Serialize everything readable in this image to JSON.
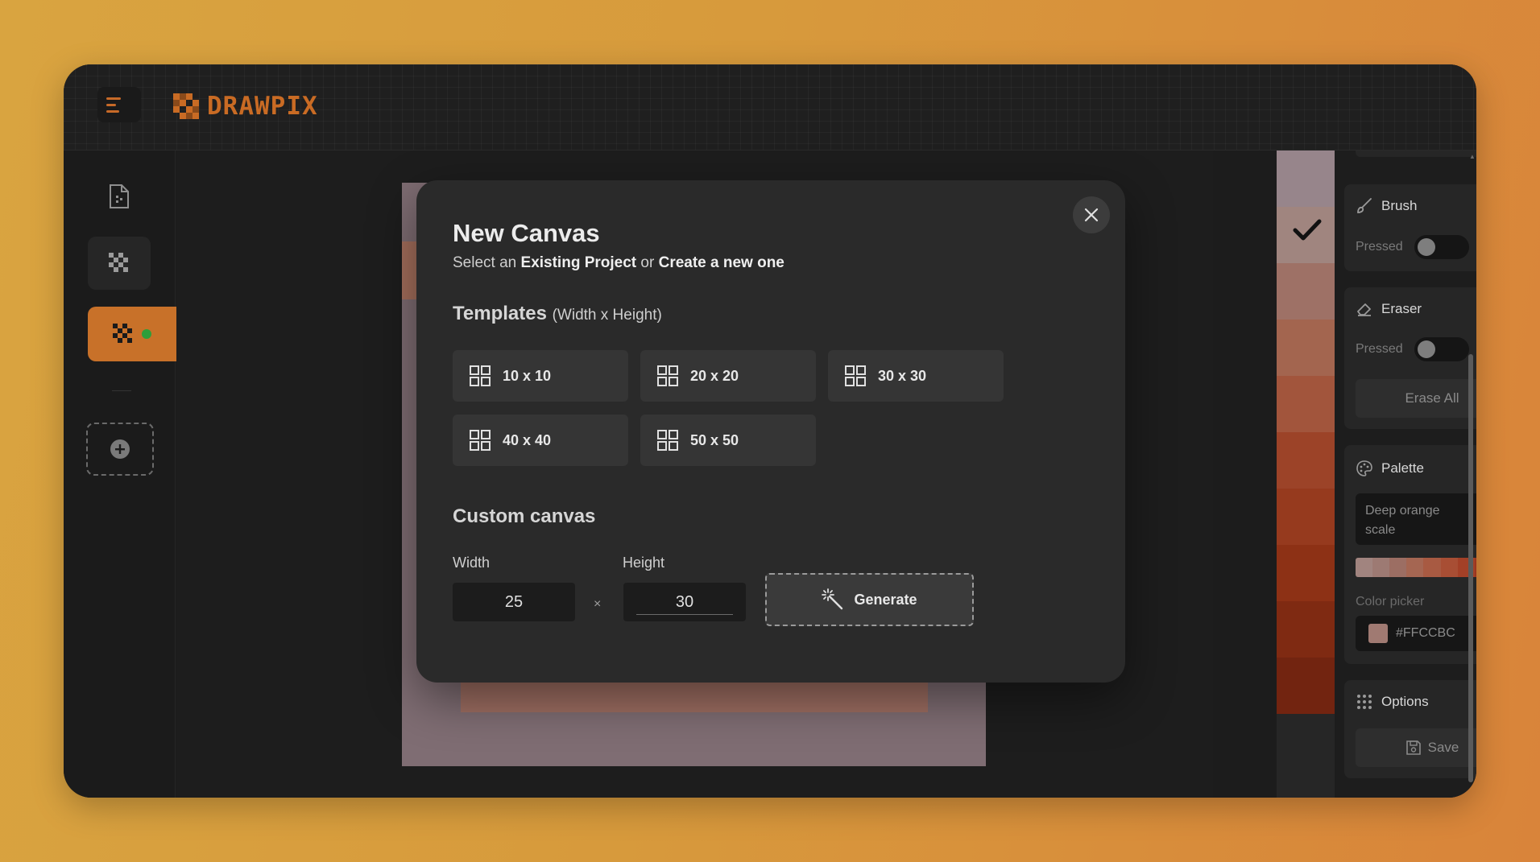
{
  "app": {
    "name": "DRAWPIX"
  },
  "modal": {
    "title": "New Canvas",
    "subtitle_prefix": "Select an",
    "subtitle_existing": "Existing Project",
    "subtitle_or": "or",
    "subtitle_create": "Create a new one",
    "templates_title": "Templates",
    "templates_sub": "(Width x Height)",
    "templates": [
      "10 x 10",
      "20 x 20",
      "30 x 30",
      "40 x 40",
      "50 x 50"
    ],
    "custom_title": "Custom canvas",
    "width_label": "Width",
    "height_label": "Height",
    "width_value": "25",
    "height_value": "30",
    "times_symbol": "×",
    "generate_label": "Generate"
  },
  "panel": {
    "brush": {
      "title": "Brush",
      "pressed_label": "Pressed"
    },
    "eraser": {
      "title": "Eraser",
      "pressed_label": "Pressed",
      "erase_all": "Erase All"
    },
    "palette": {
      "title": "Palette",
      "selected_line1": "Deep orange",
      "selected_line2": "scale",
      "swatches": [
        "#a1847f",
        "#9d7a73",
        "#9c6e63",
        "#a56652",
        "#a85a42",
        "#a84e34",
        "#a34027",
        "#9a3520",
        "#8e2d18"
      ],
      "color_picker_label": "Color picker",
      "color_value": "#FFCCBC",
      "color_chip": "#a07a72"
    },
    "options": {
      "title": "Options",
      "save_label": "Save"
    }
  },
  "palette_column": [
    "#97858b",
    "#a0857f",
    "#9e7166",
    "#a3654f",
    "#a2553c",
    "#9c4328",
    "#963a1e",
    "#8d3115",
    "#7f2a12",
    "#722410"
  ],
  "colors": {
    "accent": "#c8702a",
    "status_dot": "#2e9e3a"
  }
}
